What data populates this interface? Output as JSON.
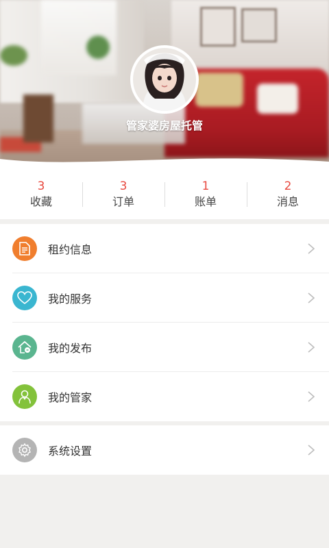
{
  "header": {
    "title": "管家婆房屋托管"
  },
  "stats": [
    {
      "count": "3",
      "label": "收藏"
    },
    {
      "count": "3",
      "label": "订单"
    },
    {
      "count": "1",
      "label": "账单"
    },
    {
      "count": "2",
      "label": "消息"
    }
  ],
  "menu": [
    {
      "label": "租约信息",
      "icon": "document-icon",
      "color": "#f07e2e"
    },
    {
      "label": "我的服务",
      "icon": "heart-icon",
      "color": "#3ab6d0"
    },
    {
      "label": "我的发布",
      "icon": "house-icon",
      "color": "#5ab58f"
    },
    {
      "label": "我的管家",
      "icon": "butler-icon",
      "color": "#83c23b"
    }
  ],
  "settings": {
    "label": "系统设置",
    "icon": "gear-icon",
    "color": "#b4b4b4"
  },
  "colors": {
    "accent": "#e8493f",
    "background": "#f1f0ee"
  }
}
